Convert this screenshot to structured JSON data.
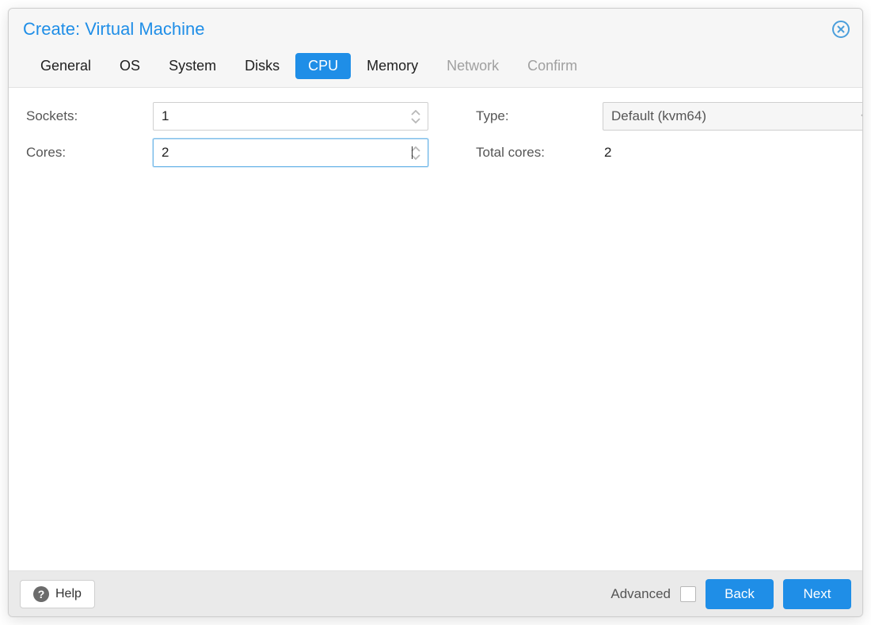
{
  "title": "Create: Virtual Machine",
  "tabs": [
    {
      "label": "General",
      "state": "enabled"
    },
    {
      "label": "OS",
      "state": "enabled"
    },
    {
      "label": "System",
      "state": "enabled"
    },
    {
      "label": "Disks",
      "state": "enabled"
    },
    {
      "label": "CPU",
      "state": "active"
    },
    {
      "label": "Memory",
      "state": "enabled"
    },
    {
      "label": "Network",
      "state": "disabled"
    },
    {
      "label": "Confirm",
      "state": "disabled"
    }
  ],
  "form": {
    "sockets_label": "Sockets:",
    "sockets_value": "1",
    "cores_label": "Cores:",
    "cores_value": "2",
    "type_label": "Type:",
    "type_value": "Default (kvm64)",
    "total_cores_label": "Total cores:",
    "total_cores_value": "2"
  },
  "footer": {
    "help_label": "Help",
    "advanced_label": "Advanced",
    "advanced_checked": false,
    "back_label": "Back",
    "next_label": "Next"
  },
  "colors": {
    "accent": "#1f8ee7"
  }
}
